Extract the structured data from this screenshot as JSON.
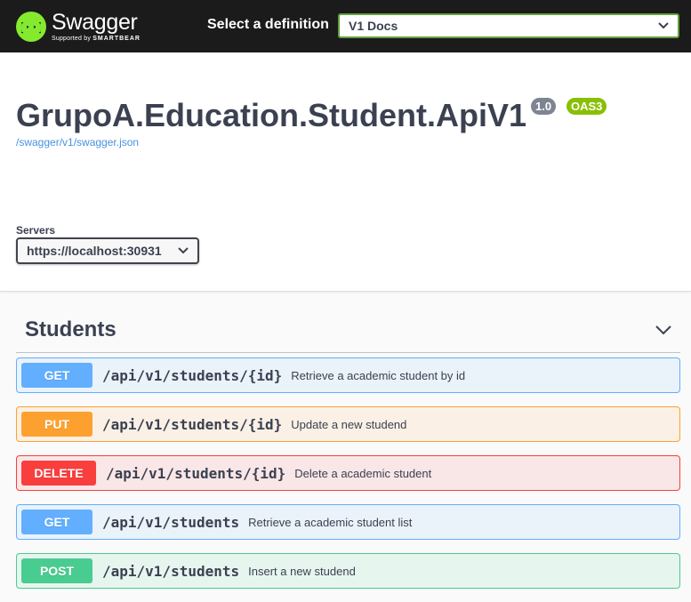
{
  "topbar": {
    "brand": "Swagger",
    "brand_sub_prefix": "Supported by",
    "brand_sub_company": "SMARTBEAR",
    "definition_label": "Select a definition",
    "definition_selected": "V1 Docs"
  },
  "info": {
    "title": "GrupoA.Education.Student.ApiV1",
    "version": "1.0",
    "oas": "OAS3",
    "spec_url": "/swagger/v1/swagger.json"
  },
  "servers": {
    "label": "Servers",
    "selected": "https://localhost:30931"
  },
  "tag": {
    "name": "Students"
  },
  "operations": [
    {
      "method": "GET",
      "path": "/api/v1/students/{id}",
      "summary": "Retrieve a academic student by id"
    },
    {
      "method": "PUT",
      "path": "/api/v1/students/{id}",
      "summary": "Update a new studend"
    },
    {
      "method": "DELETE",
      "path": "/api/v1/students/{id}",
      "summary": "Delete a academic student"
    },
    {
      "method": "GET",
      "path": "/api/v1/students",
      "summary": "Retrieve a academic student list"
    },
    {
      "method": "POST",
      "path": "/api/v1/students",
      "summary": "Insert a new studend"
    }
  ],
  "colors": {
    "get": "#61affe",
    "put": "#fca130",
    "delete": "#f93e3e",
    "post": "#49cc90",
    "brand_green": "#85ea2d",
    "oas_badge": "#89bf04",
    "version_badge": "#7d8492"
  }
}
